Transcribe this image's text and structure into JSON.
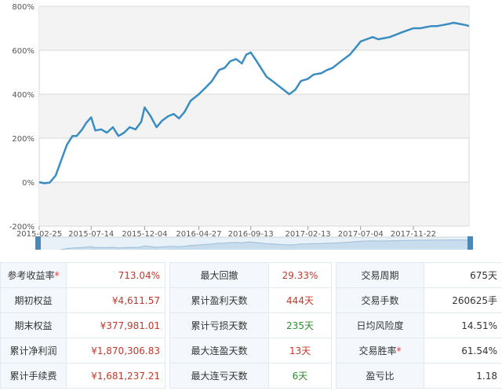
{
  "chart_data": {
    "type": "line",
    "y_ticks": [
      "800%",
      "600%",
      "400%",
      "200%",
      "0%",
      "-200%"
    ],
    "y_tick_values": [
      800,
      600,
      400,
      200,
      0,
      -200
    ],
    "ylim": [
      -200,
      800
    ],
    "x_ticks": [
      "2015-02-25",
      "2015-07-14",
      "2015-12-04",
      "2016-04-27",
      "2016-09-13",
      "2017-02-13",
      "2017-07-04",
      "2017-11-22"
    ],
    "xlim": [
      "2015-02-25",
      "2018-04-20"
    ],
    "grid": true,
    "colors": {
      "line": "#3a8dc1",
      "band": "#f3f3f3",
      "navigator": "#4c87b6"
    },
    "series": [
      {
        "x": [
          "2015-02-25",
          "2015-03-10",
          "2015-03-25",
          "2015-04-10",
          "2015-04-25",
          "2015-05-10",
          "2015-05-25",
          "2015-06-05",
          "2015-06-20",
          "2015-07-01",
          "2015-07-14",
          "2015-07-25",
          "2015-08-10",
          "2015-08-25",
          "2015-09-10",
          "2015-09-25",
          "2015-10-10",
          "2015-10-25",
          "2015-11-10",
          "2015-11-25",
          "2015-12-04",
          "2015-12-20",
          "2016-01-05",
          "2016-01-20",
          "2016-02-05",
          "2016-02-20",
          "2016-03-05",
          "2016-03-20",
          "2016-04-05",
          "2016-04-27",
          "2016-05-15",
          "2016-06-01",
          "2016-06-20",
          "2016-07-05",
          "2016-07-20",
          "2016-08-05",
          "2016-08-20",
          "2016-09-01",
          "2016-09-13",
          "2016-09-25",
          "2016-10-10",
          "2016-10-25",
          "2016-11-10",
          "2016-11-25",
          "2016-12-10",
          "2016-12-25",
          "2017-01-10",
          "2017-01-25",
          "2017-02-13",
          "2017-03-01",
          "2017-03-20",
          "2017-04-05",
          "2017-04-20",
          "2017-05-05",
          "2017-05-20",
          "2017-06-05",
          "2017-06-20",
          "2017-07-04",
          "2017-07-20",
          "2017-08-05",
          "2017-08-20",
          "2017-09-05",
          "2017-09-20",
          "2017-10-05",
          "2017-10-20",
          "2017-11-05",
          "2017-11-22",
          "2017-12-10",
          "2017-12-25",
          "2018-01-10",
          "2018-01-25",
          "2018-02-10",
          "2018-02-25",
          "2018-03-10",
          "2018-03-25",
          "2018-04-10",
          "2018-04-20"
        ],
        "y": [
          0,
          -5,
          -2,
          30,
          100,
          170,
          210,
          210,
          240,
          270,
          295,
          235,
          240,
          225,
          250,
          210,
          225,
          250,
          240,
          275,
          340,
          300,
          250,
          280,
          300,
          310,
          290,
          320,
          370,
          400,
          430,
          460,
          510,
          520,
          550,
          560,
          540,
          580,
          590,
          560,
          520,
          480,
          460,
          440,
          420,
          400,
          420,
          460,
          470,
          490,
          495,
          510,
          520,
          540,
          560,
          580,
          610,
          640,
          650,
          660,
          650,
          655,
          660,
          670,
          680,
          690,
          700,
          700,
          705,
          710,
          710,
          715,
          720,
          725,
          720,
          715,
          710
        ]
      }
    ]
  },
  "stats": {
    "rows": [
      [
        {
          "label": "参考收益率",
          "star": "*",
          "value": "713.04%",
          "cls": "red"
        },
        {
          "label": "最大回撤",
          "star": "",
          "value": "29.33%",
          "cls": "red"
        },
        {
          "label": "交易周期",
          "star": "",
          "value": "675天",
          "cls": "dark"
        }
      ],
      [
        {
          "label": "期初权益",
          "star": "",
          "value": "¥4,611.57",
          "cls": "red"
        },
        {
          "label": "累计盈利天数",
          "star": "",
          "value": "444天",
          "cls": "red"
        },
        {
          "label": "交易手数",
          "star": "",
          "value": "260625手",
          "cls": "dark"
        }
      ],
      [
        {
          "label": "期末权益",
          "star": "",
          "value": "¥377,981.01",
          "cls": "red"
        },
        {
          "label": "累计亏损天数",
          "star": "",
          "value": "235天",
          "cls": "green"
        },
        {
          "label": "日均风险度",
          "star": "",
          "value": "14.51%",
          "cls": "dark"
        }
      ],
      [
        {
          "label": "累计净利润",
          "star": "",
          "value": "¥1,870,306.83",
          "cls": "red"
        },
        {
          "label": "最大连盈天数",
          "star": "",
          "value": "13天",
          "cls": "red"
        },
        {
          "label": "交易胜率",
          "star": "*",
          "value": "61.54%",
          "cls": "dark"
        }
      ],
      [
        {
          "label": "累计手续费",
          "star": "",
          "value": "¥1,681,237.21",
          "cls": "red"
        },
        {
          "label": "最大连亏天数",
          "star": "",
          "value": "6天",
          "cls": "green"
        },
        {
          "label": "盈亏比",
          "star": "",
          "value": "1.18",
          "cls": "dark"
        }
      ]
    ]
  }
}
